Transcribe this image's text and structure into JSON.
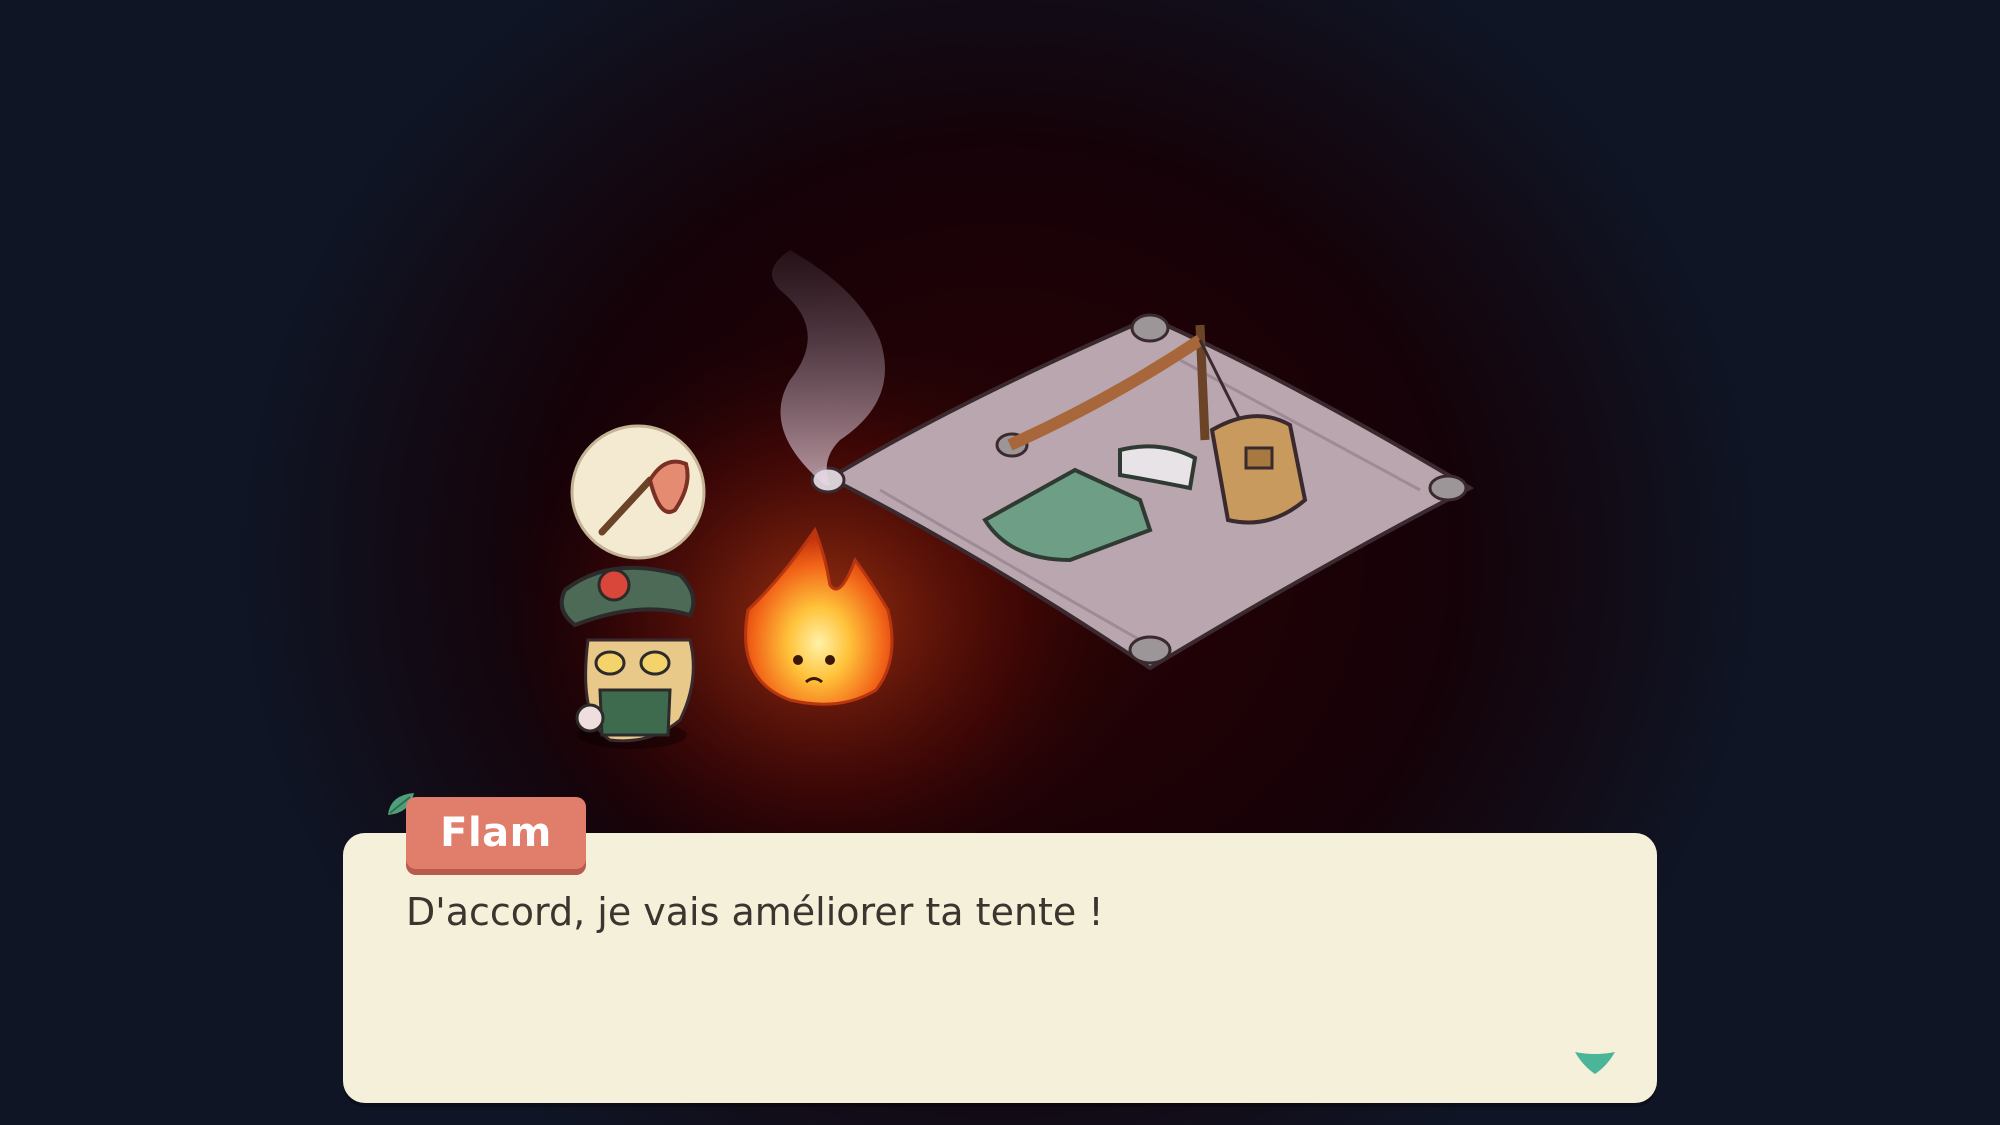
{
  "dialog": {
    "speaker": "Flam",
    "text": "D'accord, je vais améliorer ta tente !",
    "continue_icon": "advance-arrow-icon"
  },
  "scene": {
    "thought_bubble_icon": "bug-net-icon",
    "characters": [
      "player-character",
      "flam-fire-spirit"
    ],
    "props": [
      "tent-tarp",
      "sleeping-bag",
      "backpack",
      "smoke"
    ]
  },
  "colors": {
    "dialog_bg": "#f5f0d9",
    "name_tag_bg": "#e07d6b",
    "arrow": "#4bb59a",
    "leaf": "#4fa07a"
  }
}
